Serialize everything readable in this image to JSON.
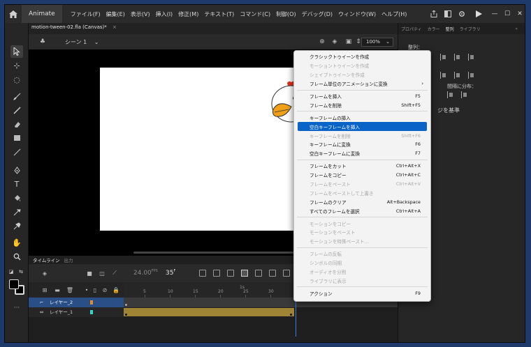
{
  "app": {
    "tab_label": "Animate",
    "menu": [
      "ファイル(F)",
      "編集(E)",
      "表示(V)",
      "挿入(I)",
      "修正(M)",
      "テキスト(T)",
      "コマンド(C)",
      "制御(O)",
      "デバッグ(D)",
      "ウィンドウ(W)",
      "ヘルプ(H)"
    ]
  },
  "document": {
    "tab_title": "motion-tween-02.fla (Canvas)*",
    "close_glyph": "×"
  },
  "stage": {
    "scene_label": "シーン 1",
    "zoom": "100%"
  },
  "right_panel": {
    "tabs": [
      "プロパティ",
      "カラー",
      "整列",
      "ライブラリ"
    ],
    "active_tab": "整列",
    "align_label": "整列：",
    "distribute_label": "間隔に分布：",
    "stage_basis_label": "ジを基準"
  },
  "timeline": {
    "tabs": [
      "タイムライン",
      "出力"
    ],
    "fps": "24.00",
    "fps_unit": "FPS",
    "current_frame": "35",
    "frame_unit": "F",
    "ruler_numbers": [
      "1s",
      "5",
      "10",
      "15",
      "20",
      "25",
      "30"
    ],
    "layers": [
      {
        "name": "レイヤー_2",
        "color": "#e38b2c",
        "selected": true
      },
      {
        "name": "レイヤー_1",
        "color": "#2bd6d6",
        "selected": false
      }
    ]
  },
  "context_menu": {
    "groups": [
      [
        {
          "label": "クラシックトゥイーンを作成",
          "shortcut": "",
          "enabled": true
        },
        {
          "label": "モーショントゥイーンを作成",
          "shortcut": "",
          "enabled": false
        },
        {
          "label": "シェイプトゥイーンを作成",
          "shortcut": "",
          "enabled": false
        },
        {
          "label": "フレーム単位のアニメーションに変換",
          "shortcut": "›",
          "enabled": true
        }
      ],
      [
        {
          "label": "フレームを挿入",
          "shortcut": "F5",
          "enabled": true
        },
        {
          "label": "フレームを削除",
          "shortcut": "Shift+F5",
          "enabled": true
        }
      ],
      [
        {
          "label": "キーフレームの挿入",
          "shortcut": "",
          "enabled": true
        },
        {
          "label": "空白キーフレームを挿入",
          "shortcut": "",
          "enabled": true,
          "highlighted": true
        },
        {
          "label": "キーフレームを削除",
          "shortcut": "Shift+F6",
          "enabled": false
        },
        {
          "label": "キーフレームに変換",
          "shortcut": "F6",
          "enabled": true
        },
        {
          "label": "空白キーフレームに変換",
          "shortcut": "F7",
          "enabled": true
        }
      ],
      [
        {
          "label": "フレームをカット",
          "shortcut": "Ctrl+Alt+X",
          "enabled": true
        },
        {
          "label": "フレームをコピー",
          "shortcut": "Ctrl+Alt+C",
          "enabled": true
        },
        {
          "label": "フレームをペースト",
          "shortcut": "Ctrl+Alt+V",
          "enabled": false
        },
        {
          "label": "フレームをペーストして上書き",
          "shortcut": "",
          "enabled": false
        },
        {
          "label": "フレームのクリア",
          "shortcut": "Alt+Backspace",
          "enabled": true
        },
        {
          "label": "すべてのフレームを選択",
          "shortcut": "Ctrl+Alt+A",
          "enabled": true
        }
      ],
      [
        {
          "label": "モーションをコピー",
          "shortcut": "",
          "enabled": false
        },
        {
          "label": "モーションをペースト",
          "shortcut": "",
          "enabled": false
        },
        {
          "label": "モーションを特殊ペースト...",
          "shortcut": "",
          "enabled": false
        }
      ],
      [
        {
          "label": "フレームの反転",
          "shortcut": "",
          "enabled": false
        },
        {
          "label": "シンボルの同期",
          "shortcut": "",
          "enabled": false
        },
        {
          "label": "オーディオを分割",
          "shortcut": "",
          "enabled": false
        },
        {
          "label": "ライブラリに表示",
          "shortcut": "",
          "enabled": false
        }
      ],
      [
        {
          "label": "アクション",
          "shortcut": "F9",
          "enabled": true
        }
      ]
    ]
  }
}
